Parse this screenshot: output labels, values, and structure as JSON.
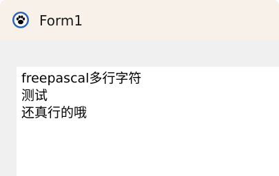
{
  "window": {
    "title": "Form1",
    "icon": "lazarus-paw-icon"
  },
  "memo": {
    "lines": [
      "freepascal多行字符",
      "测试",
      "还真行的哦"
    ]
  },
  "colors": {
    "titlebar_bg": "#f8f1ea",
    "client_bg": "#f0f0f0",
    "memo_bg": "#ffffff",
    "icon_ring": "#2a63b8"
  }
}
